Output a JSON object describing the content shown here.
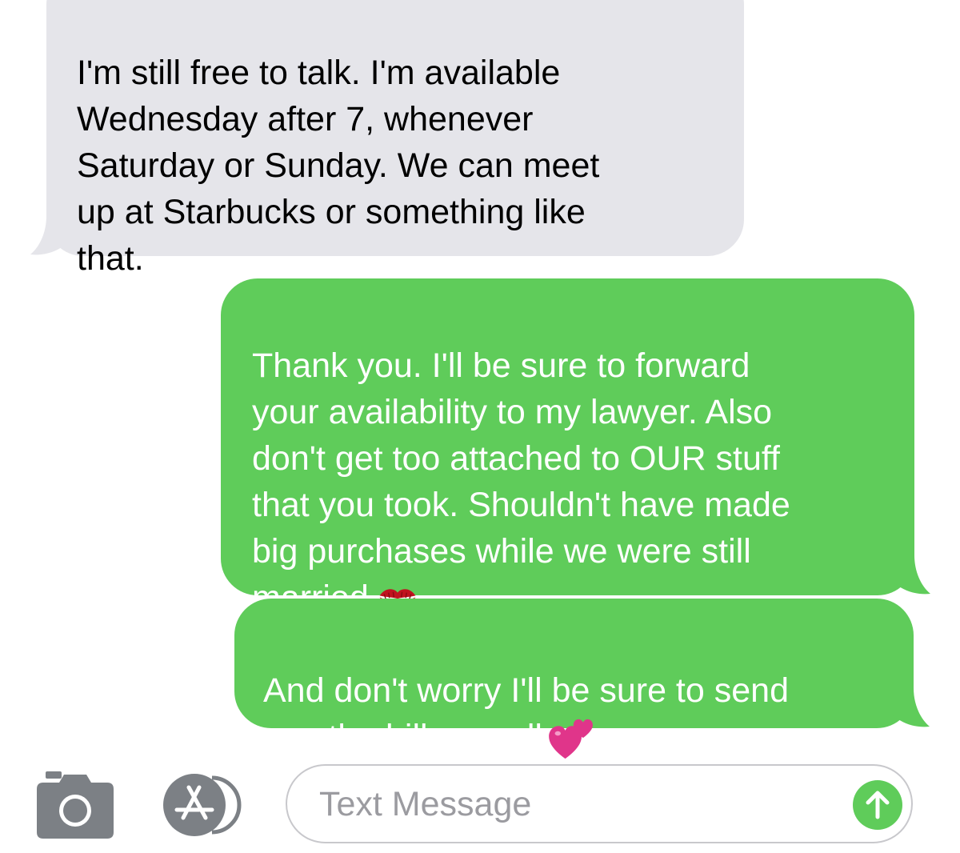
{
  "conversation": {
    "messages": [
      {
        "direction": "received",
        "text": "I'm still free to talk. I'm available\nWednesday after 7, whenever\nSaturday or Sunday. We can meet\nup at Starbucks or something like\nthat."
      },
      {
        "direction": "sent",
        "text": "Thank you. I'll be sure to forward\nyour availability to my lawyer. Also\ndon't get too attached to OUR stuff\nthat you took. Shouldn't have made\nbig purchases while we were still\nmarried",
        "emoji": "kiss-mark"
      },
      {
        "direction": "sent",
        "text": "And don't worry I'll be sure to send\nyou the bill as well",
        "emoji": "two-hearts"
      }
    ]
  },
  "input_bar": {
    "placeholder": "Text Message",
    "camera_icon": "camera-icon",
    "apps_icon": "app-store-icon",
    "send_icon": "arrow-up-icon",
    "accent_color": "#5fcc5a"
  },
  "colors": {
    "received_bubble": "#e5e5ea",
    "sent_bubble": "#5fcc5a",
    "icon_gray": "#7c8085"
  }
}
